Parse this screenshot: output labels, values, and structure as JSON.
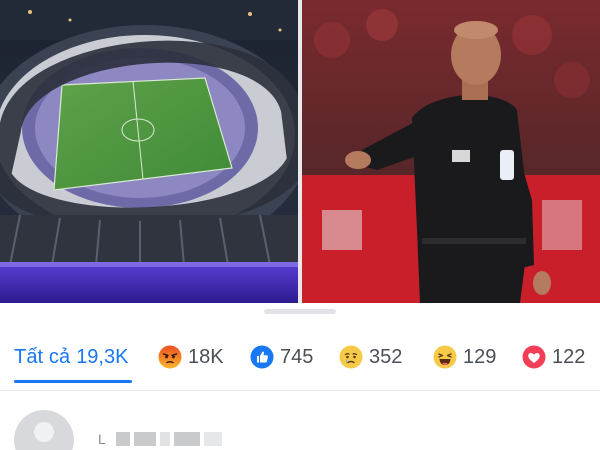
{
  "photos": [
    {
      "name": "stadium-photo",
      "alt": "Stadium"
    },
    {
      "name": "referee-photo",
      "alt": "Referee"
    }
  ],
  "reactions": {
    "all": {
      "label": "Tất cả",
      "count": "19,3K"
    },
    "angry": {
      "icon": "angry-reaction-icon",
      "count": "18K"
    },
    "like": {
      "icon": "like-reaction-icon",
      "count": "745"
    },
    "sad": {
      "icon": "sad-reaction-icon",
      "count": "352"
    },
    "haha": {
      "icon": "haha-reaction-icon",
      "count": "129"
    },
    "love": {
      "icon": "love-reaction-icon",
      "count": "122"
    }
  },
  "list": [
    {
      "initial": "L"
    }
  ],
  "colors": {
    "accent": "#1877f2",
    "text": "#4b4f56",
    "angry": "#f05a24",
    "like": "#1877f2",
    "love": "#f33e58",
    "haha": "#f7b125"
  }
}
